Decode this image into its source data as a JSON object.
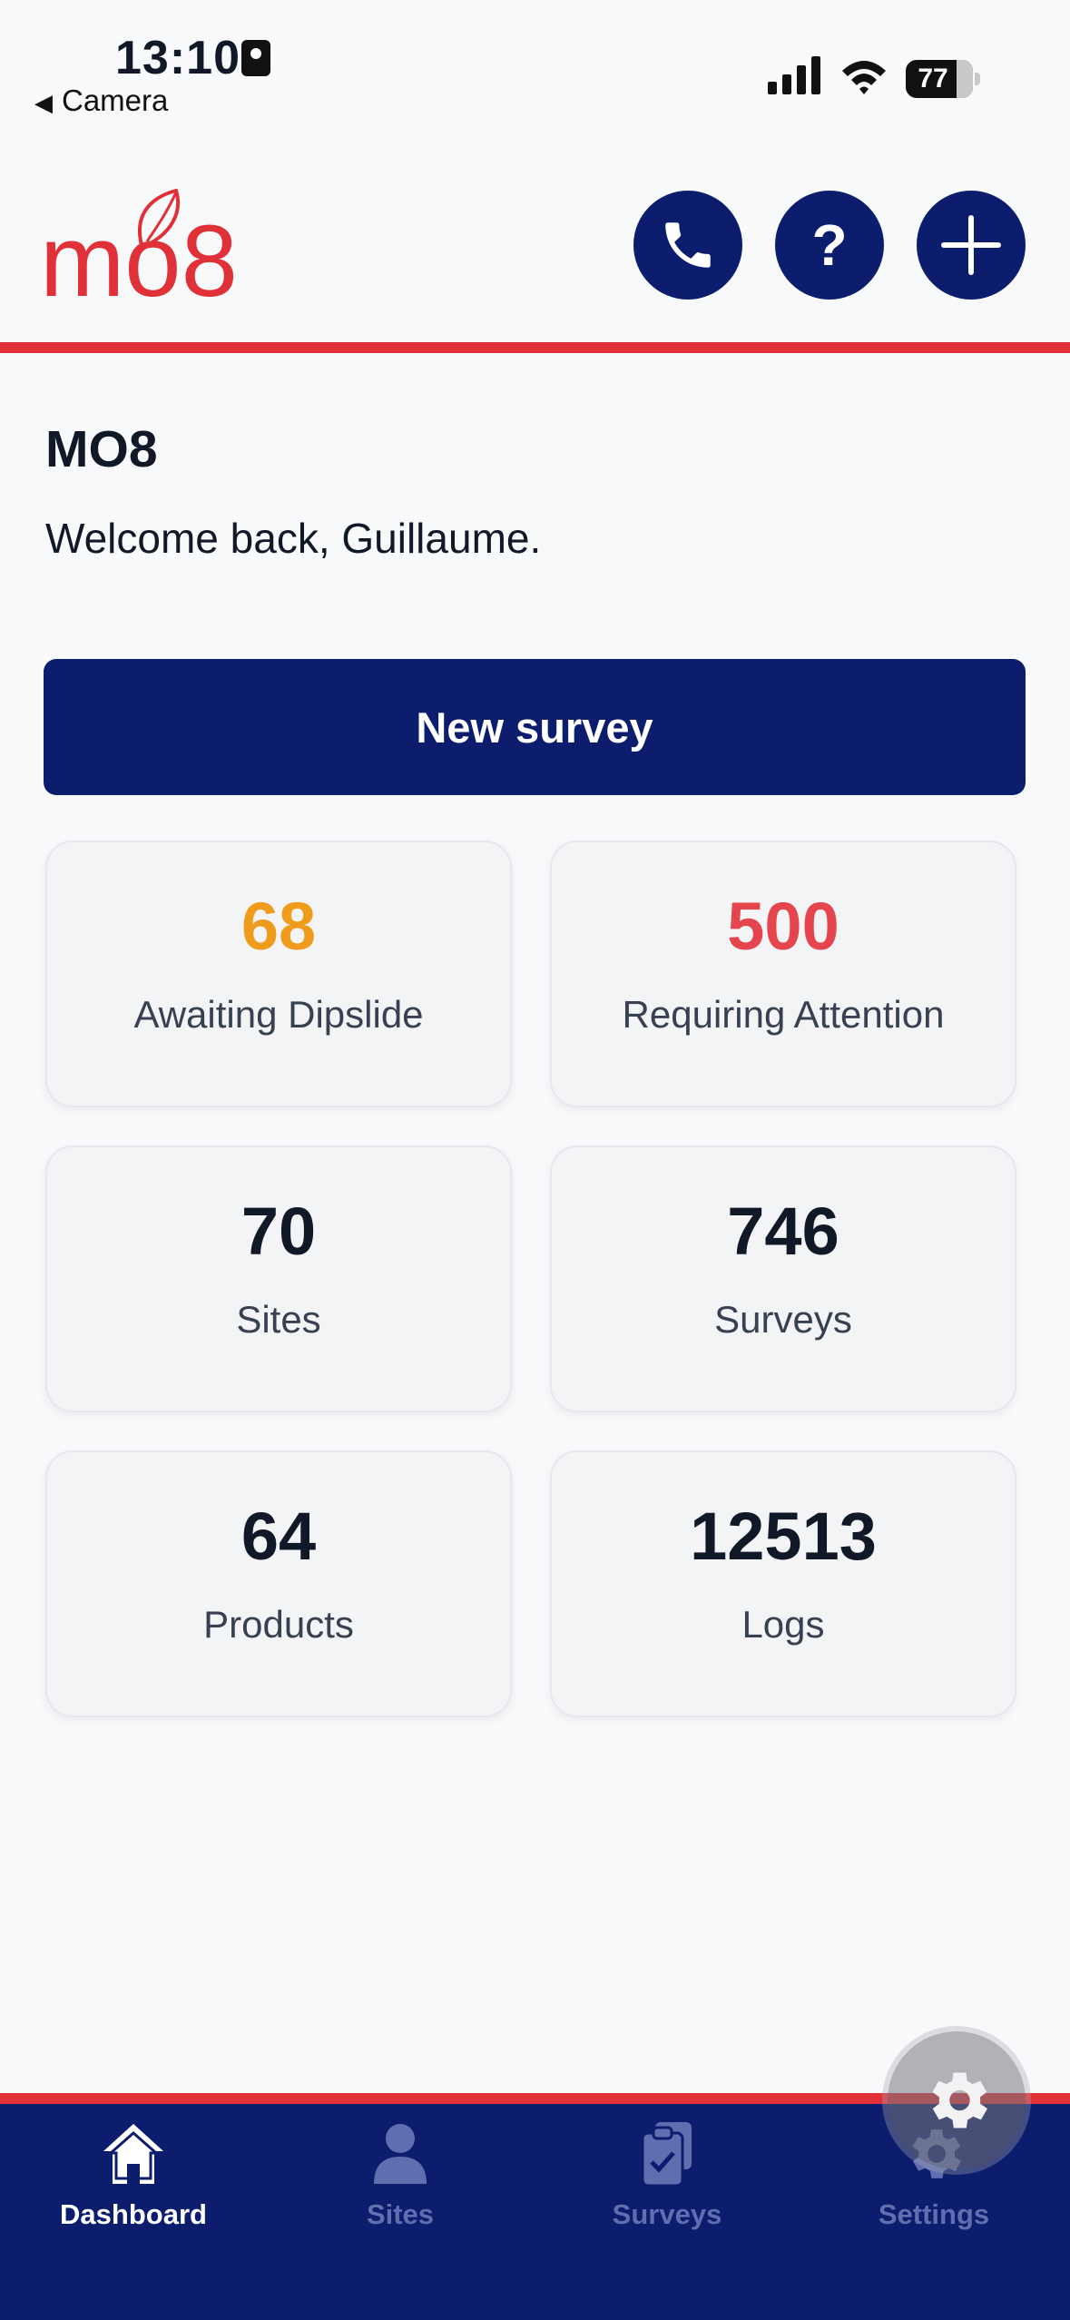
{
  "status_bar": {
    "time": "13:10",
    "back_label": "Camera",
    "battery": "77"
  },
  "header": {
    "logo_text": "mo8",
    "buttons": [
      "phone",
      "help",
      "add"
    ]
  },
  "main": {
    "title": "MO8",
    "welcome": "Welcome back, Guillaume.",
    "new_survey_label": "New survey",
    "stats": [
      {
        "value": "68",
        "label": "Awaiting Dipslide",
        "color": "#ef9b1c"
      },
      {
        "value": "500",
        "label": "Requiring Attention",
        "color": "#e5464e"
      },
      {
        "value": "70",
        "label": "Sites"
      },
      {
        "value": "746",
        "label": "Surveys"
      },
      {
        "value": "64",
        "label": "Products"
      },
      {
        "value": "12513",
        "label": "Logs"
      }
    ]
  },
  "bottom_nav": {
    "items": [
      {
        "label": "Dashboard",
        "icon": "home-icon",
        "active": true
      },
      {
        "label": "Sites",
        "icon": "person-icon"
      },
      {
        "label": "Surveys",
        "icon": "clipboard-check-icon"
      },
      {
        "label": "Settings",
        "icon": "gear-icon"
      }
    ]
  },
  "colors": {
    "navy": "#0c1d6e",
    "accent_red": "#e03138",
    "warning_orange": "#ef9b1c",
    "alert_red": "#e5464e"
  }
}
